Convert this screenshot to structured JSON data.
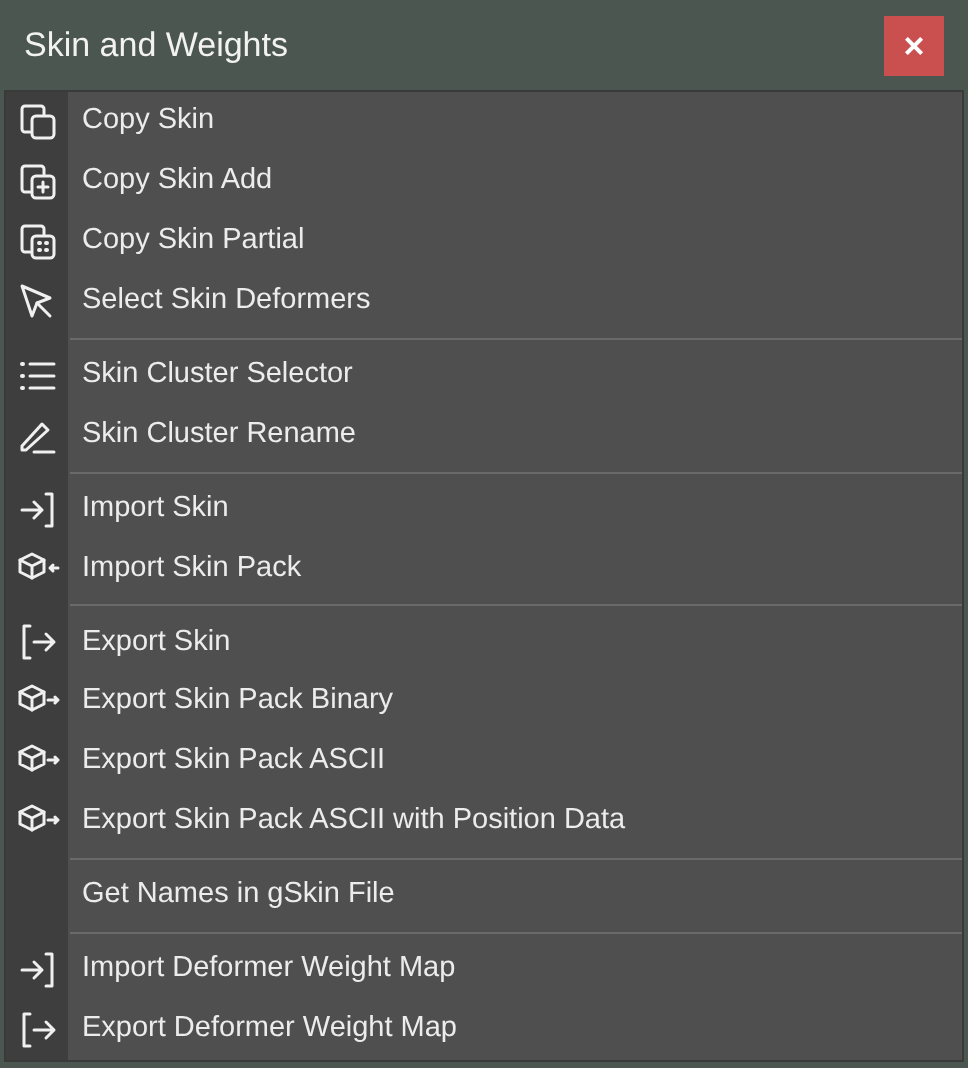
{
  "window": {
    "title": "Skin and Weights",
    "close": "×"
  },
  "groups": [
    [
      {
        "label": "Copy Skin"
      },
      {
        "label": "Copy Skin Add"
      },
      {
        "label": "Copy Skin Partial"
      },
      {
        "label": "Select Skin Deformers"
      }
    ],
    [
      {
        "label": "Skin Cluster Selector"
      },
      {
        "label": "Skin Cluster Rename"
      }
    ],
    [
      {
        "label": "Import Skin"
      },
      {
        "label": "Import Skin Pack"
      }
    ],
    [
      {
        "label": "Export Skin"
      },
      {
        "label": "Export Skin Pack Binary"
      },
      {
        "label": "Export Skin Pack ASCII"
      },
      {
        "label": "Export Skin Pack ASCII with Position Data"
      }
    ],
    [
      {
        "label": "Get Names in gSkin File"
      }
    ],
    [
      {
        "label": "Import Deformer Weight Map"
      },
      {
        "label": "Export Deformer Weight Map"
      }
    ]
  ]
}
